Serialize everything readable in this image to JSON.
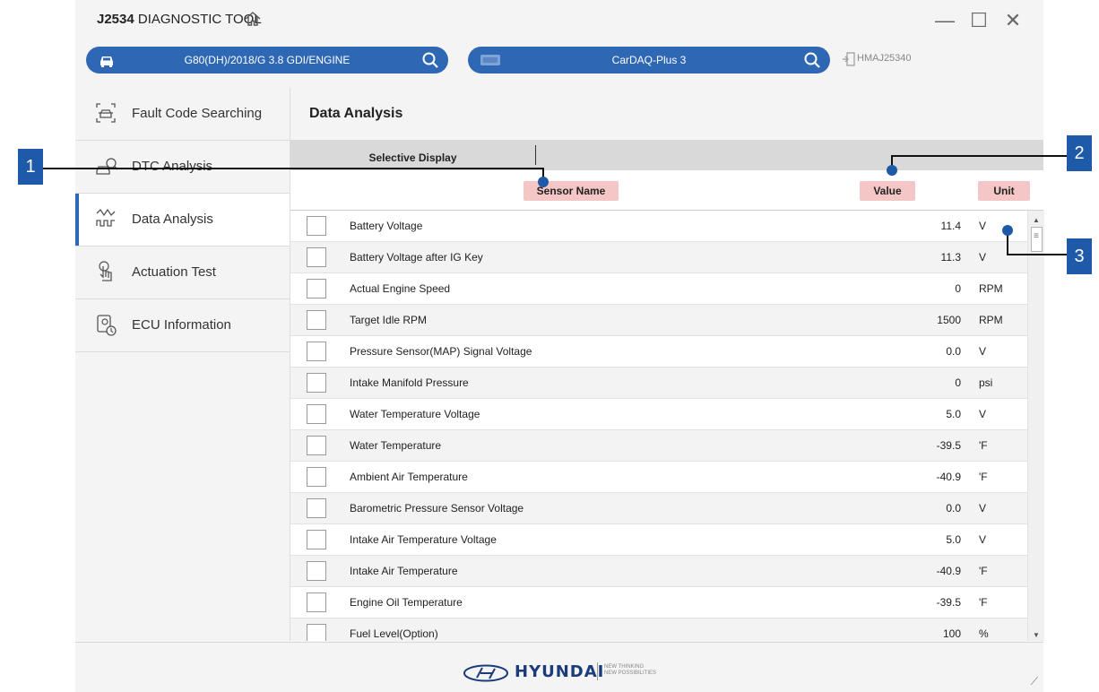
{
  "window": {
    "title_bold": "J2534",
    "title_rest": " DIAGNOSTIC TOOL",
    "controls": {
      "minimize": "—",
      "maximize": "☐",
      "close": "✕"
    }
  },
  "toolbar": {
    "vehicle": "G80(DH)/2018/G 3.8 GDI/ENGINE",
    "device": "CarDAQ-Plus 3",
    "connection": "HMAJ25340"
  },
  "sidebar": {
    "items": [
      {
        "label": "Fault Code Searching",
        "icon": "car-scan-icon"
      },
      {
        "label": "DTC Analysis",
        "icon": "car-diagnose-icon"
      },
      {
        "label": "Data Analysis",
        "icon": "waveform-icon",
        "active": true
      },
      {
        "label": "Actuation Test",
        "icon": "hand-touch-icon"
      },
      {
        "label": "ECU Information",
        "icon": "ecu-info-icon"
      }
    ]
  },
  "main": {
    "title": "Data Analysis",
    "selective_display": "Selective Display",
    "columns": {
      "sensor": "Sensor Name",
      "value": "Value",
      "unit": "Unit"
    }
  },
  "rows": [
    {
      "name": "Battery Voltage",
      "value": "11.4",
      "unit": "V"
    },
    {
      "name": "Battery Voltage after IG Key",
      "value": "11.3",
      "unit": "V"
    },
    {
      "name": "Actual Engine Speed",
      "value": "0",
      "unit": "RPM"
    },
    {
      "name": "Target Idle RPM",
      "value": "1500",
      "unit": "RPM"
    },
    {
      "name": "Pressure Sensor(MAP) Signal Voltage",
      "value": "0.0",
      "unit": "V"
    },
    {
      "name": "Intake Manifold Pressure",
      "value": "0",
      "unit": "psi"
    },
    {
      "name": "Water Temperature Voltage",
      "value": "5.0",
      "unit": "V"
    },
    {
      "name": "Water Temperature",
      "value": "-39.5",
      "unit": "'F"
    },
    {
      "name": "Ambient Air Temperature",
      "value": "-40.9",
      "unit": "'F"
    },
    {
      "name": "Barometric Pressure Sensor Voltage",
      "value": "0.0",
      "unit": "V"
    },
    {
      "name": "Intake Air Temperature Voltage",
      "value": "5.0",
      "unit": "V"
    },
    {
      "name": "Intake Air Temperature",
      "value": "-40.9",
      "unit": "'F"
    },
    {
      "name": "Engine Oil Temperature",
      "value": "-39.5",
      "unit": "'F"
    },
    {
      "name": "Fuel Level(Option)",
      "value": "100",
      "unit": "%"
    },
    {
      "name": "",
      "value": "",
      "unit": ""
    }
  ],
  "footer": {
    "brand": "HYUNDAI",
    "tagline1": "NEW THINKING",
    "tagline2": "NEW POSSIBILITIES"
  },
  "callouts": [
    "1",
    "2",
    "3"
  ],
  "colors": {
    "accent": "#2e68b4",
    "header_highlight": "#f5c6c6",
    "callout": "#1e5aa8"
  }
}
